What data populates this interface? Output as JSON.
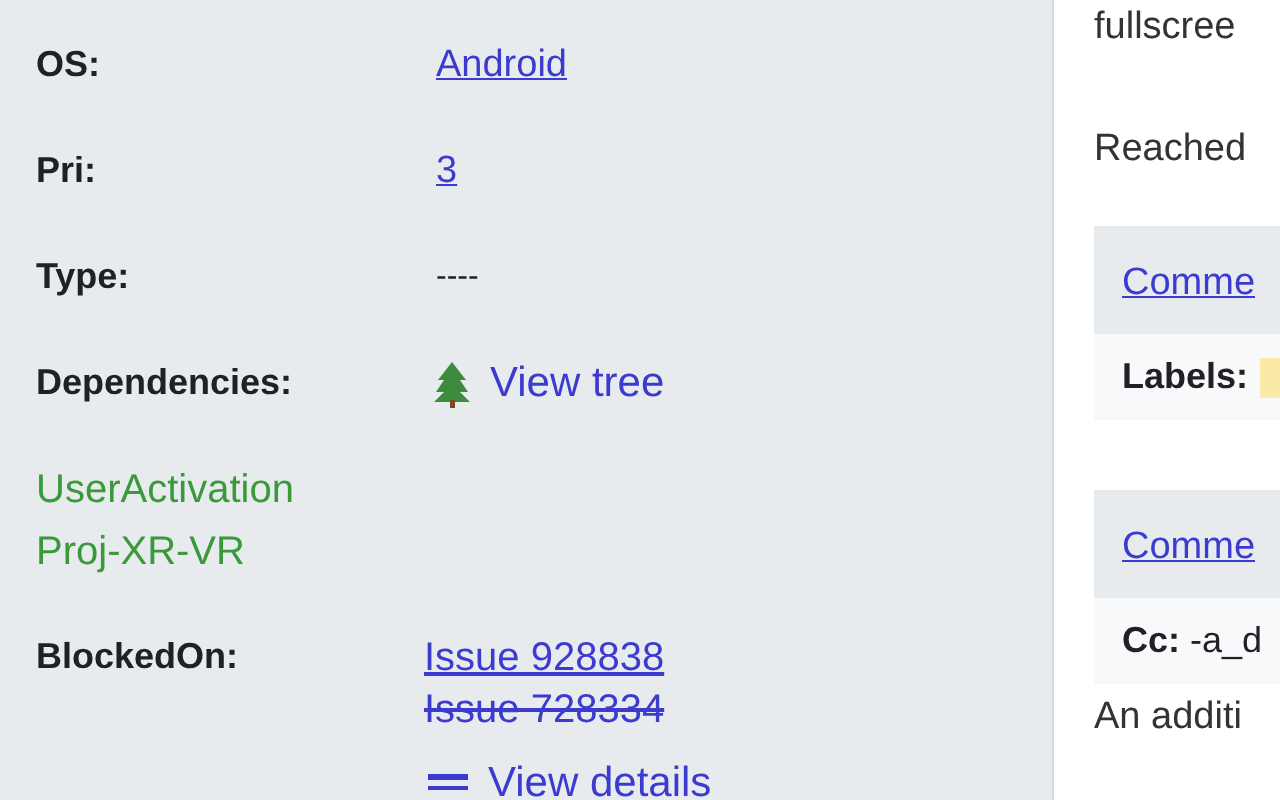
{
  "fields": [
    {
      "label": "OS:",
      "kind": "link",
      "value": "Android"
    },
    {
      "label": "Pri:",
      "kind": "link",
      "value": "3"
    },
    {
      "label": "Type:",
      "kind": "text",
      "value": "----"
    },
    {
      "label": "Dependencies:",
      "kind": "tree",
      "value": "View tree"
    }
  ],
  "labels": [
    "UserActivation",
    "Proj-XR-VR"
  ],
  "blocked_on": {
    "label": "BlockedOn:",
    "issues": [
      {
        "text": "Issue 928838",
        "closed": false
      },
      {
        "text": "Issue 728334",
        "closed": true
      }
    ],
    "details": "View details"
  },
  "description": [
    "fullscree",
    "Reached"
  ],
  "comments": [
    {
      "link": "Comme",
      "field": "Labels:",
      "chip": true
    },
    {
      "link": "Comme",
      "field": "Cc:",
      "value": " -a_d",
      "chip": false
    }
  ],
  "trailing_text": "An additi"
}
